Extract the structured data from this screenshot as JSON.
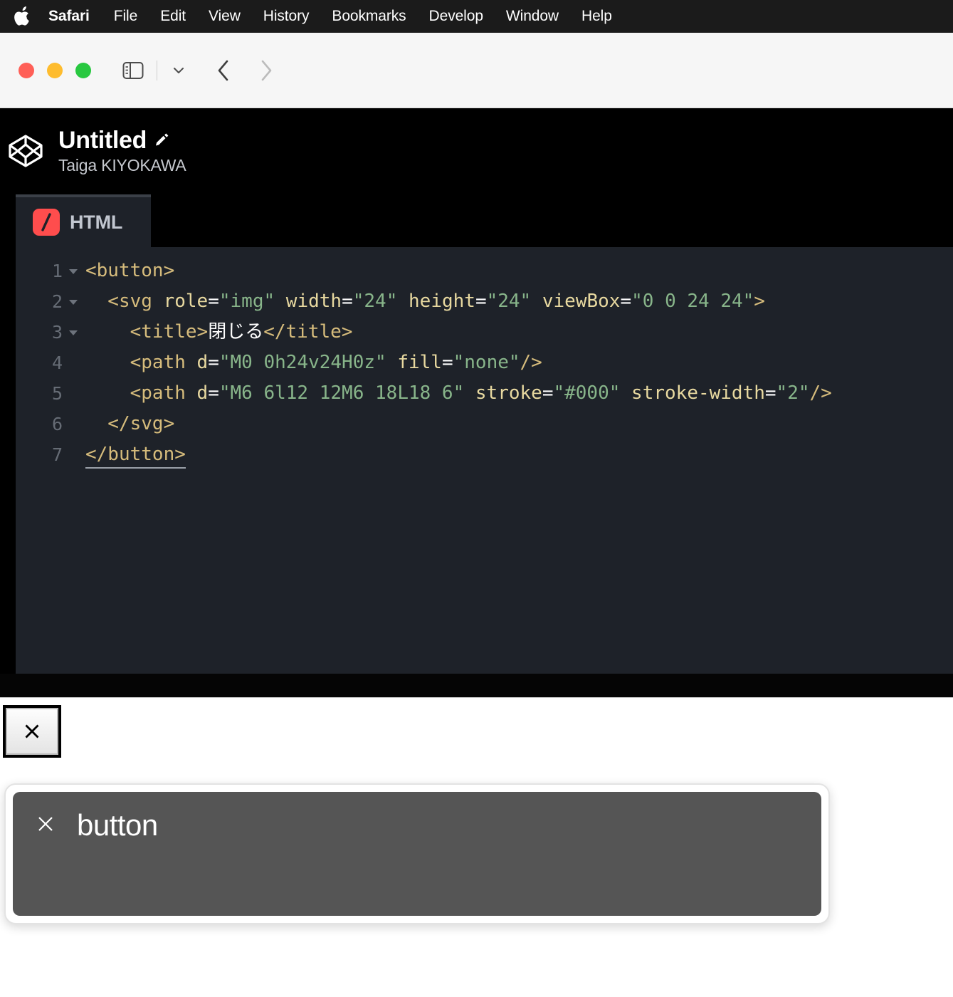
{
  "menubar": {
    "apple_icon": "apple-logo-icon",
    "items": [
      {
        "label": "Safari",
        "bold": true
      },
      {
        "label": "File",
        "bold": false
      },
      {
        "label": "Edit",
        "bold": false
      },
      {
        "label": "View",
        "bold": false
      },
      {
        "label": "History",
        "bold": false
      },
      {
        "label": "Bookmarks",
        "bold": false
      },
      {
        "label": "Develop",
        "bold": false
      },
      {
        "label": "Window",
        "bold": false
      },
      {
        "label": "Help",
        "bold": false
      }
    ]
  },
  "toolbar": {
    "traffic_lights": {
      "close": "#ff5f57",
      "minimize": "#febc2e",
      "maximize": "#28c840"
    },
    "sidebar_icon": "sidebar-toggle-icon",
    "dropdown_icon": "chevron-down-icon",
    "back_icon": "chevron-left-icon",
    "forward_icon": "chevron-right-icon"
  },
  "codepen": {
    "logo_icon": "codepen-logo-icon",
    "title": "Untitled",
    "edit_icon": "pencil-icon",
    "author": "Taiga KIYOKAWA"
  },
  "editor": {
    "tabs": [
      {
        "label": "HTML",
        "badge_icon": "html-slash-icon",
        "badge_color": "#ff4d4d",
        "active": true
      }
    ],
    "line_numbers": [
      "1",
      "2",
      "3",
      "4",
      "5",
      "6",
      "7"
    ],
    "fold_markers": [
      true,
      true,
      true,
      false,
      false,
      false,
      false
    ],
    "lines": [
      [
        {
          "text": "<button>",
          "type": "tag"
        }
      ],
      [
        {
          "text": "  <svg ",
          "type": "tag"
        },
        {
          "text": "role",
          "type": "attr"
        },
        {
          "text": "=",
          "type": "eq"
        },
        {
          "text": "\"img\"",
          "type": "val"
        },
        {
          "text": " ",
          "type": "plain"
        },
        {
          "text": "width",
          "type": "attr"
        },
        {
          "text": "=",
          "type": "eq"
        },
        {
          "text": "\"24\"",
          "type": "val"
        },
        {
          "text": " ",
          "type": "plain"
        },
        {
          "text": "height",
          "type": "attr"
        },
        {
          "text": "=",
          "type": "eq"
        },
        {
          "text": "\"24\"",
          "type": "val"
        },
        {
          "text": " ",
          "type": "plain"
        },
        {
          "text": "viewBox",
          "type": "attr"
        },
        {
          "text": "=",
          "type": "eq"
        },
        {
          "text": "\"0 0 24 24\"",
          "type": "val"
        },
        {
          "text": ">",
          "type": "tag"
        }
      ],
      [
        {
          "text": "    <title>",
          "type": "tag"
        },
        {
          "text": "閉じる",
          "type": "text"
        },
        {
          "text": "</title>",
          "type": "tag"
        }
      ],
      [
        {
          "text": "    <path ",
          "type": "tag"
        },
        {
          "text": "d",
          "type": "attr"
        },
        {
          "text": "=",
          "type": "eq"
        },
        {
          "text": "\"M0 0h24v24H0z\"",
          "type": "val"
        },
        {
          "text": " ",
          "type": "plain"
        },
        {
          "text": "fill",
          "type": "attr"
        },
        {
          "text": "=",
          "type": "eq"
        },
        {
          "text": "\"none\"",
          "type": "val"
        },
        {
          "text": "/>",
          "type": "tag"
        }
      ],
      [
        {
          "text": "    <path ",
          "type": "tag"
        },
        {
          "text": "d",
          "type": "attr"
        },
        {
          "text": "=",
          "type": "eq"
        },
        {
          "text": "\"M6 6l12 12M6 18L18 6\"",
          "type": "val"
        },
        {
          "text": " ",
          "type": "plain"
        },
        {
          "text": "stroke",
          "type": "attr"
        },
        {
          "text": "=",
          "type": "eq"
        },
        {
          "text": "\"#000\"",
          "type": "val"
        },
        {
          "text": " ",
          "type": "plain"
        },
        {
          "text": "stroke-width",
          "type": "attr"
        },
        {
          "text": "=",
          "type": "eq"
        },
        {
          "text": "\"2\"",
          "type": "val"
        },
        {
          "text": "/>",
          "type": "tag"
        }
      ],
      [
        {
          "text": "  </svg>",
          "type": "tag"
        }
      ],
      [
        {
          "text": "</button>",
          "type": "tag",
          "cursorline": true
        }
      ]
    ]
  },
  "result": {
    "close_button": {
      "icon": "close-x-icon",
      "focused": true
    }
  },
  "voiceover": {
    "icon": "close-x-icon",
    "caption": "button"
  }
}
